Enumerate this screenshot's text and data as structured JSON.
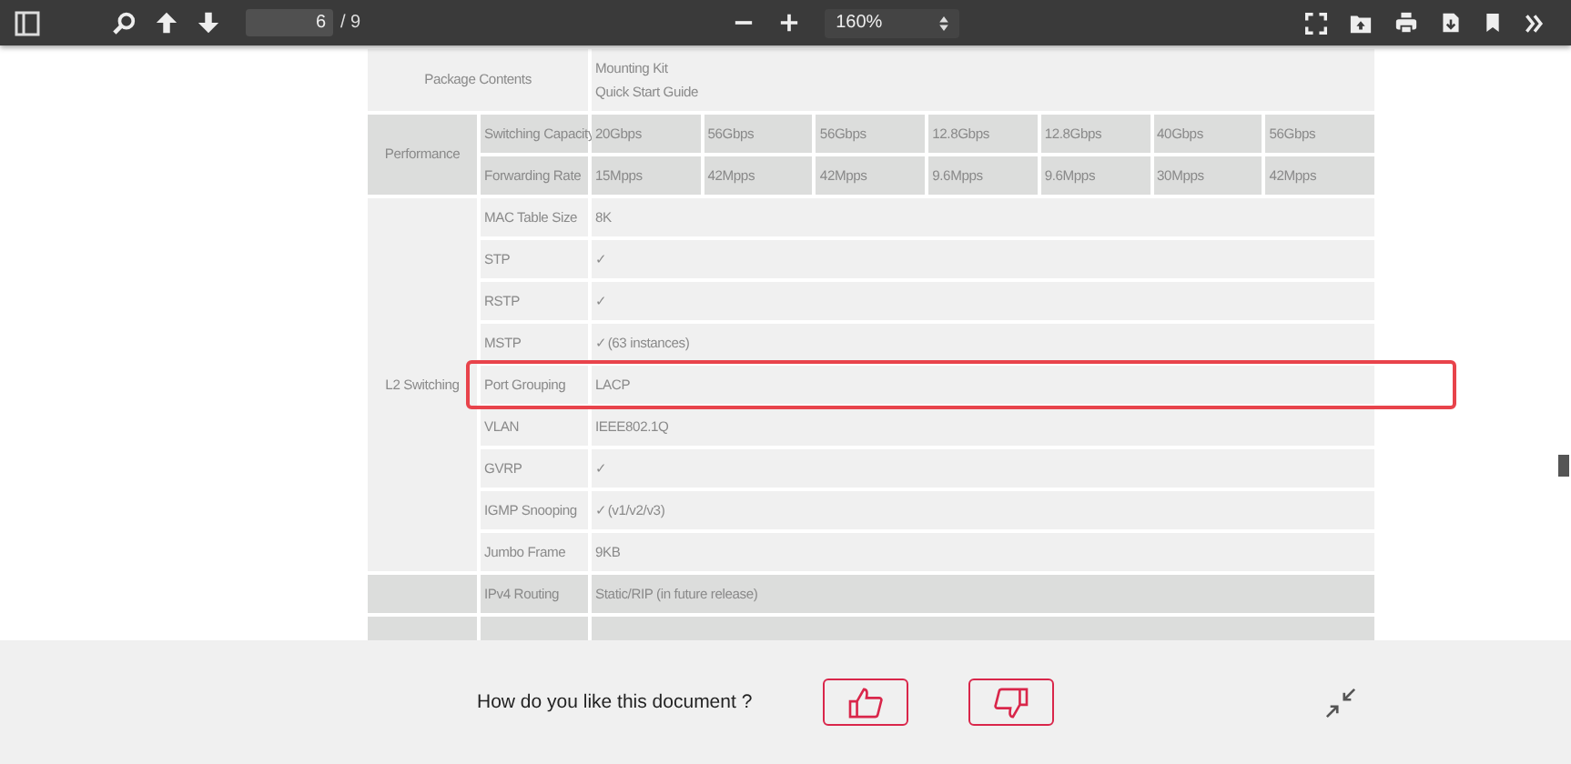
{
  "toolbar": {
    "page": "6",
    "page_count": "/ 9",
    "zoom": "160%"
  },
  "spec_table": {
    "sections": [
      {
        "kind": "merged",
        "shaded": false,
        "group": "Package Contents",
        "lines": [
          "Mounting Kit",
          "Quick Start Guide"
        ]
      },
      {
        "kind": "grid",
        "shaded": true,
        "group": "Performance",
        "rows": [
          {
            "label": "Switching Capacity",
            "values": [
              "20Gbps",
              "56Gbps",
              "56Gbps",
              "12.8Gbps",
              "12.8Gbps",
              "40Gbps",
              "56Gbps"
            ]
          },
          {
            "label": "Forwarding Rate",
            "values": [
              "15Mpps",
              "42Mpps",
              "42Mpps",
              "9.6Mpps",
              "9.6Mpps",
              "30Mpps",
              "42Mpps"
            ]
          }
        ]
      },
      {
        "kind": "single",
        "shaded": false,
        "group": "L2 Switching",
        "rows": [
          {
            "label": "MAC Table Size",
            "value": "8K"
          },
          {
            "label": "STP",
            "value": "✓"
          },
          {
            "label": "RSTP",
            "value": "✓"
          },
          {
            "label": "MSTP",
            "value": "✓(63 instances)"
          },
          {
            "label": "Port Grouping",
            "value": "LACP",
            "highlighted": true
          },
          {
            "label": "VLAN",
            "value": "IEEE802.1Q"
          },
          {
            "label": "GVRP",
            "value": "✓"
          },
          {
            "label": "IGMP Snooping",
            "value": "✓(v1/v2/v3)"
          },
          {
            "label": "Jumbo Frame",
            "value": "9KB"
          }
        ]
      },
      {
        "kind": "single",
        "shaded": true,
        "rows": [
          {
            "label": "IPv4 Routing",
            "value": "Static/RIP (in future release)"
          }
        ]
      }
    ]
  },
  "feedback": {
    "question": "How do you like this document ?"
  }
}
